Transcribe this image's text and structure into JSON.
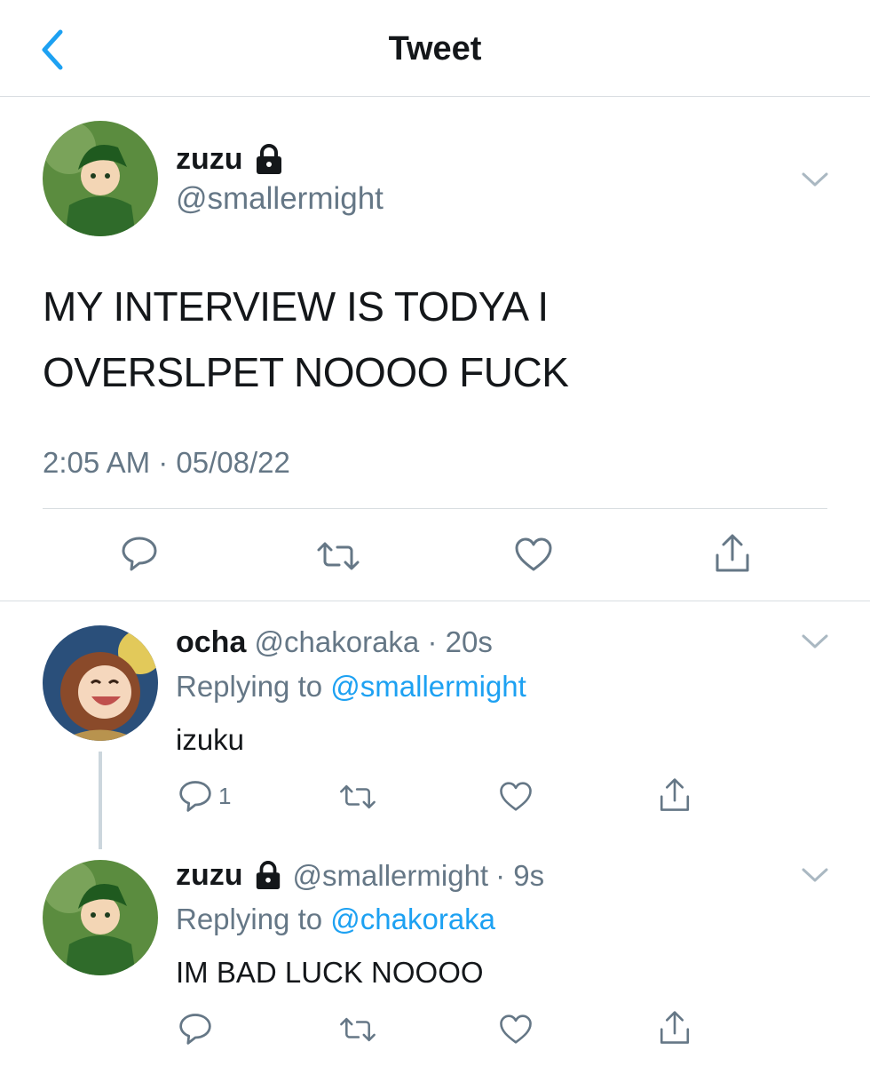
{
  "header": {
    "title": "Tweet"
  },
  "main_tweet": {
    "name": "zuzu",
    "handle": "@smallermight",
    "text_line1": "MY INTERVIEW IS TODYA I",
    "text_line2": "OVERSLPET NOOOO FUCK",
    "timestamp": "2:05 AM · 05/08/22"
  },
  "replies": [
    {
      "name": "ocha",
      "handle": "@chakoraka",
      "time": "· 20s",
      "replying_prefix": "Replying to",
      "replying_to": "@smallermight",
      "text": "izuku",
      "reply_count": "1"
    },
    {
      "name": "zuzu",
      "handle": "@smallermight",
      "time": "· 9s",
      "replying_prefix": "Replying to",
      "replying_to": "@chakoraka",
      "text": "IM BAD LUCK NOOOO"
    }
  ],
  "colors": {
    "accent": "#1da1f2",
    "secondary_text": "#657786",
    "divider": "#d8dde1"
  },
  "icons": [
    "chevron-left-icon",
    "lock-icon",
    "chevron-down-icon",
    "reply-icon",
    "retweet-icon",
    "like-icon",
    "share-icon"
  ]
}
